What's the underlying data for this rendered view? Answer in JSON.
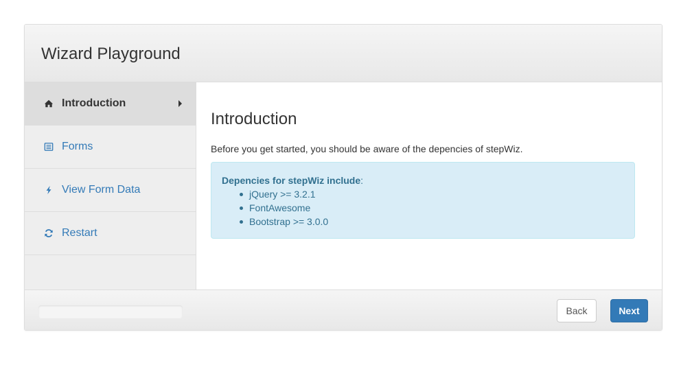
{
  "header": {
    "title": "Wizard Playground"
  },
  "sidebar": {
    "items": [
      {
        "label": "Introduction",
        "icon": "home-icon",
        "active": true
      },
      {
        "label": "Forms",
        "icon": "list-alt-icon",
        "active": false
      },
      {
        "label": "View Form Data",
        "icon": "bolt-icon",
        "active": false
      },
      {
        "label": "Restart",
        "icon": "refresh-icon",
        "active": false
      }
    ]
  },
  "content": {
    "title": "Introduction",
    "text": "Before you get started, you should be aware of the depencies of stepWiz.",
    "info": {
      "heading": "Depencies for stepWiz include",
      "heading_suffix": ":",
      "items": [
        "jQuery >= 3.2.1",
        "FontAwesome",
        "Bootstrap >= 3.0.0"
      ]
    }
  },
  "footer": {
    "progress": 0,
    "back_label": "Back",
    "next_label": "Next"
  },
  "colors": {
    "primary": "#337ab7",
    "info_bg": "#d9edf7",
    "info_text": "#31708f",
    "sidebar_bg": "#eeeeee"
  }
}
